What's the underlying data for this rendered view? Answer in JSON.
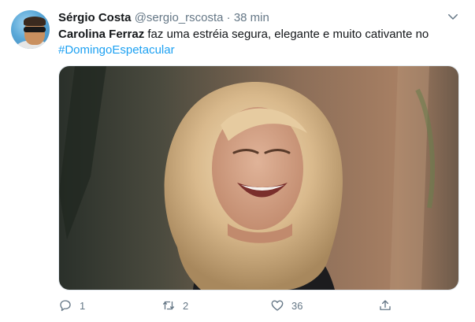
{
  "tweet": {
    "author_name": "Sérgio Costa",
    "handle": "@sergio_rscosta",
    "separator": "·",
    "time": "38 min",
    "mention_bold": "Carolina Ferraz",
    "text": " faz uma estréia segura, elegante e muito cativante no",
    "hashtag": "#DomingoEspetacular"
  },
  "actions": {
    "reply_count": "1",
    "retweet_count": "2",
    "like_count": "36"
  },
  "icons": [
    "chevron-down-icon",
    "reply-icon",
    "retweet-icon",
    "like-icon",
    "share-icon"
  ],
  "colors": {
    "link": "#1da1f2",
    "secondary": "#657786",
    "text": "#14171a"
  }
}
